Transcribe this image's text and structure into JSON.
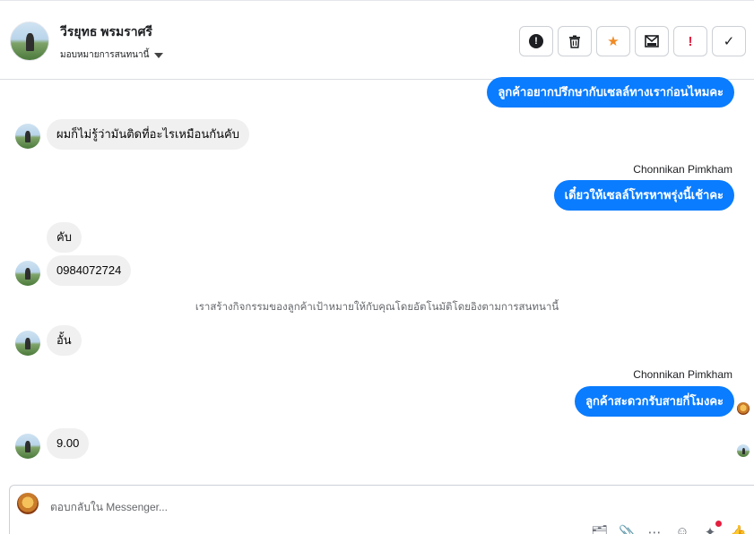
{
  "header": {
    "name": "วีรยุทธ พรมราศรี",
    "assign_label": "มอบหมายการสนทนานี้"
  },
  "actions": [
    {
      "icon": "alert-circle-icon",
      "glyph": "!"
    },
    {
      "icon": "trash-icon",
      "glyph": "🗑"
    },
    {
      "icon": "star-icon",
      "glyph": "★"
    },
    {
      "icon": "mark-unread-icon",
      "glyph": "✉"
    },
    {
      "icon": "exclamation-icon",
      "glyph": "!"
    },
    {
      "icon": "check-icon",
      "glyph": "✓"
    }
  ],
  "messages": {
    "m1": "ลูกค้าอยากปรึกษากับเซลล์ทางเราก่อนไหมคะ",
    "m2": "ผมก็ไม่รู้ว่ามันติดที่อะไรเหมือนกันคับ",
    "sender1": "Chonnikan Pimkham",
    "m3": "เดี๋ยวให้เซลล์โทรหาพรุ่งนี้เช้าคะ",
    "m4": "คับ",
    "m5": "0984072724",
    "system": "เราสร้างกิจกรรมของลูกค้าเป้าหมายให้กับคุณโดยอัตโนมัติโดยอิงตามการสนทนานี้",
    "m6": "อั้น",
    "sender2": "Chonnikan Pimkham",
    "m7": "ลูกค้าสะดวกรับสายกี่โมงคะ",
    "m8": "9.00"
  },
  "composer": {
    "placeholder": "ตอบกลับใน Messenger..."
  },
  "composer_tools": [
    "briefcase-icon",
    "paperclip-icon",
    "saved-reply-icon",
    "emoji-icon",
    "gift-icon",
    "like-icon"
  ]
}
